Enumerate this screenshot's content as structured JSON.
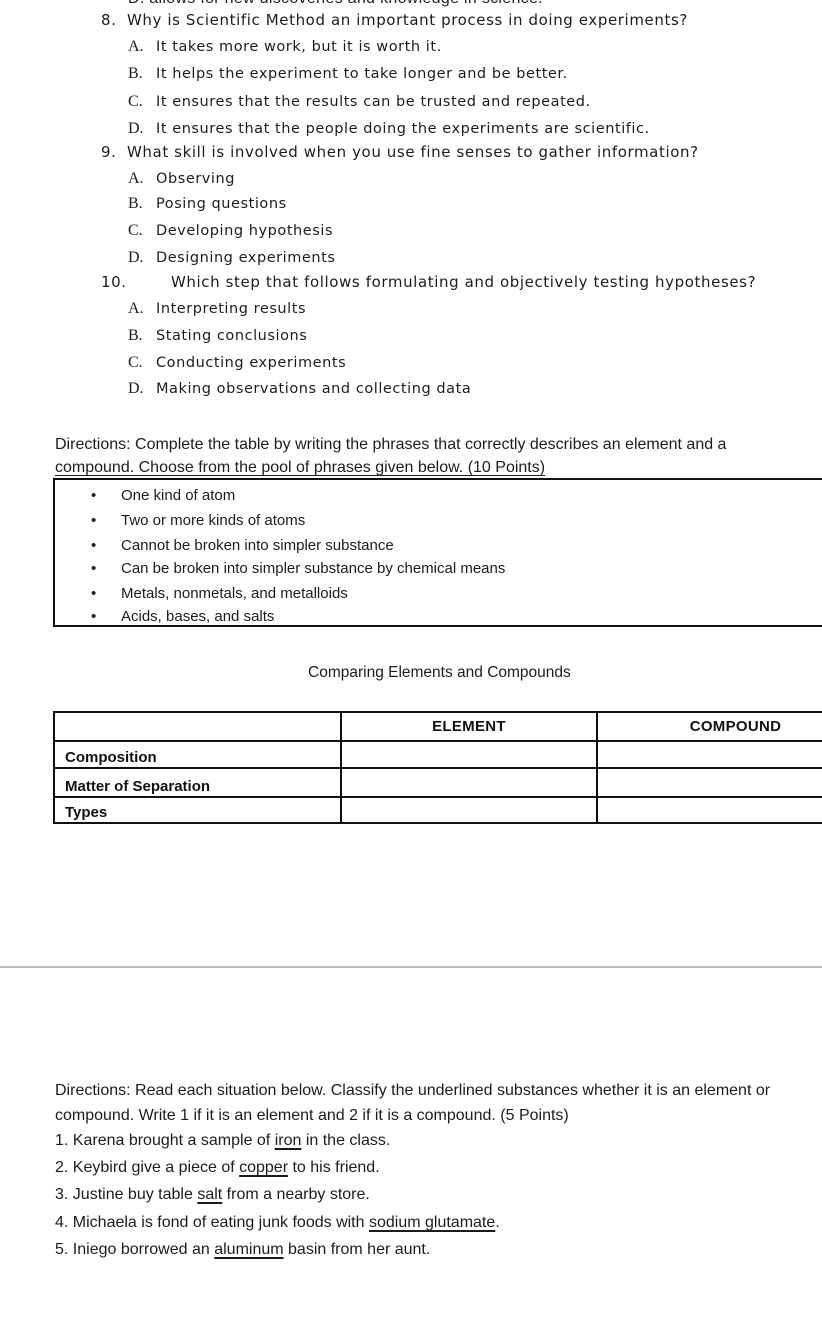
{
  "cut_off_line": "D. allows for new discoveries and knowledge in science.",
  "questions": [
    {
      "number": "8.",
      "text": "Why is Scientific Method an important process in doing experiments?",
      "options": [
        {
          "letter": "A.",
          "text": "It takes more work, but it is worth it."
        },
        {
          "letter": "B.",
          "text": "It helps the experiment to take longer and be better."
        },
        {
          "letter": "C.",
          "text": "It ensures that the results can be trusted and repeated."
        },
        {
          "letter": "D.",
          "text": "It ensures that the people doing the experiments are scientific."
        }
      ]
    },
    {
      "number": "9.",
      "text": "What skill is involved when you use fine senses to gather information?",
      "options": [
        {
          "letter": "A.",
          "text": "Observing"
        },
        {
          "letter": "B.",
          "text": "Posing questions"
        },
        {
          "letter": "C.",
          "text": "Developing hypothesis"
        },
        {
          "letter": "D.",
          "text": "Designing experiments"
        }
      ]
    },
    {
      "number": "10.",
      "text": "Which step that follows formulating and objectively testing hypotheses?",
      "options": [
        {
          "letter": "A.",
          "text": "Interpreting results"
        },
        {
          "letter": "B.",
          "text": "Stating conclusions"
        },
        {
          "letter": "C.",
          "text": "Conducting experiments"
        },
        {
          "letter": "D.",
          "text": "Making observations and collecting data"
        }
      ]
    }
  ],
  "table_section": {
    "directions_line1": "Directions: Complete the table by writing the phrases that correctly describes an element and a",
    "directions_line2": "compound. Choose from the pool of phrases given below. (10 Points)",
    "pool": [
      "One kind of atom",
      "Two or more kinds of atoms",
      "Cannot be broken into simpler substance",
      "Can be broken into simpler substance by chemical means",
      "Metals, nonmetals, and metalloids",
      "Acids, bases, and salts"
    ],
    "bullet": "•",
    "caption": "Comparing Elements and Compounds",
    "headers": [
      "",
      "ELEMENT",
      "COMPOUND"
    ],
    "rows": [
      {
        "label": "Composition",
        "element": "",
        "compound": ""
      },
      {
        "label": "Matter of Separation",
        "element": "",
        "compound": ""
      },
      {
        "label": "Types",
        "element": "",
        "compound": ""
      }
    ]
  },
  "classify_section": {
    "directions_line1": "Directions: Read each situation below. Classify the underlined substances whether it is an element or",
    "directions_line2": "compound. Write 1 if it is an element and 2 if it is a compound.  (5 Points)",
    "items": [
      {
        "before": "1. Karena brought a sample of ",
        "substance": "iron",
        "after": " in the class."
      },
      {
        "before": "2. Keybird give a piece of ",
        "substance": "copper",
        "after": " to his friend."
      },
      {
        "before": "3. Justine buy table ",
        "substance": "salt",
        "after": " from a nearby store."
      },
      {
        "before": "4. Michaela is fond of eating junk foods with ",
        "substance": "sodium glutamate",
        "after": "."
      },
      {
        "before": "5. Iniego borrowed an ",
        "substance": "aluminum",
        "after": " basin from her aunt."
      }
    ]
  }
}
